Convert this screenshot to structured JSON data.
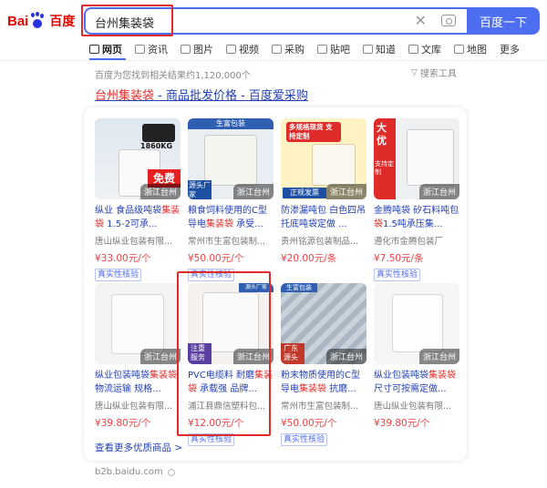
{
  "header": {
    "logo_text_1": "Bai",
    "logo_text_2": "du",
    "logo_text_cn": "百度",
    "search_value": "台州集装袋",
    "search_button": "百度一下"
  },
  "tabs": [
    {
      "label": "网页",
      "icon": "search-icon"
    },
    {
      "label": "资讯",
      "icon": "news-icon"
    },
    {
      "label": "图片",
      "icon": "image-icon"
    },
    {
      "label": "视频",
      "icon": "video-icon"
    },
    {
      "label": "采购",
      "icon": "purchase-icon"
    },
    {
      "label": "贴吧",
      "icon": "tieba-icon"
    },
    {
      "label": "知道",
      "icon": "question-icon"
    },
    {
      "label": "文库",
      "icon": "doc-icon"
    },
    {
      "label": "地图",
      "icon": "map-icon"
    },
    {
      "label": "更多",
      "icon": ""
    }
  ],
  "result_count": "百度为您找到相关结果约1,120,000个",
  "search_tools": "搜索工具",
  "result_title": {
    "highlight": "台州集装袋",
    "rest": " - 商品批发价格 - 百度爱采购"
  },
  "products": [
    {
      "location": "浙江台州",
      "name_pre": "纵业 食品级吨袋",
      "name_hl": "集装袋",
      "name_post": " 1.5-2可承...",
      "shop": "唐山纵业包装有限...",
      "price": "¥33.00元/个",
      "verify": "真实性核验",
      "img_text": "1860KG",
      "img_badge": "免费"
    },
    {
      "location": "浙江台州",
      "name_pre": "粮食饲料使用的C型导电",
      "name_hl": "集装袋",
      "name_post": " 承受...",
      "shop": "常州市生富包装制...",
      "price": "¥50.00元/个",
      "verify": "真实性核验",
      "img_text": "生富包装",
      "img_badge": "源头厂家"
    },
    {
      "location": "浙江台州",
      "name_pre": "防渗漏吨包 白色四吊托底吨袋定做 ...",
      "name_hl": "",
      "name_post": "",
      "shop": "贵州铭源包装制品...",
      "price": "¥20.00元/条",
      "verify": "",
      "img_text": "多规格现货 支持定制",
      "img_badge": "正规发票"
    },
    {
      "location": "浙江台州",
      "name_pre": "金腾吨袋 矽石料吨包",
      "name_hl": "袋",
      "name_post": "1.5吨承压集...",
      "shop": "遵化市金腾包装厂",
      "price": "¥7.50元/条",
      "verify": "真实性核验",
      "img_text": "大优",
      "img_badge": "支持定制"
    },
    {
      "location": "浙江台州",
      "name_pre": "纵业包装吨袋",
      "name_hl": "集装袋",
      "name_post": "物流运输 规格...",
      "shop": "唐山纵业包装有限...",
      "price": "¥39.80元/个",
      "verify": "",
      "img_text": "",
      "img_badge": ""
    },
    {
      "location": "浙江台州",
      "name_pre": "PVC电缆料 耐磨",
      "name_hl": "集装袋",
      "name_post": " 承载强 品牌...",
      "shop": "浦江县鼎信塑料包...",
      "price": "¥12.00元/个",
      "verify": "真实性核验",
      "img_text": "源头厂家",
      "img_badge": "注重服务"
    },
    {
      "location": "浙江台州",
      "name_pre": "粉末物质使用的C型导电",
      "name_hl": "集装袋",
      "name_post": " 抗磨...",
      "shop": "常州市生富包装制...",
      "price": "¥50.00元/个",
      "verify": "真实性核验",
      "img_text": "生富包装",
      "img_badge": "广东源头"
    },
    {
      "location": "浙江台州",
      "name_pre": "纵业包装吨袋",
      "name_hl": "集装袋",
      "name_post": "尺寸可按需定做...",
      "shop": "唐山纵业包装有限...",
      "price": "¥39.80元/个",
      "verify": "",
      "img_text": "",
      "img_badge": ""
    }
  ],
  "more_link": "查看更多优质商品 >",
  "footer_url": "b2b.baidu.com",
  "colors": {
    "accent": "#4e6ef2",
    "highlight": "#e02b2b",
    "price": "#f04142",
    "link": "#2440b3"
  }
}
